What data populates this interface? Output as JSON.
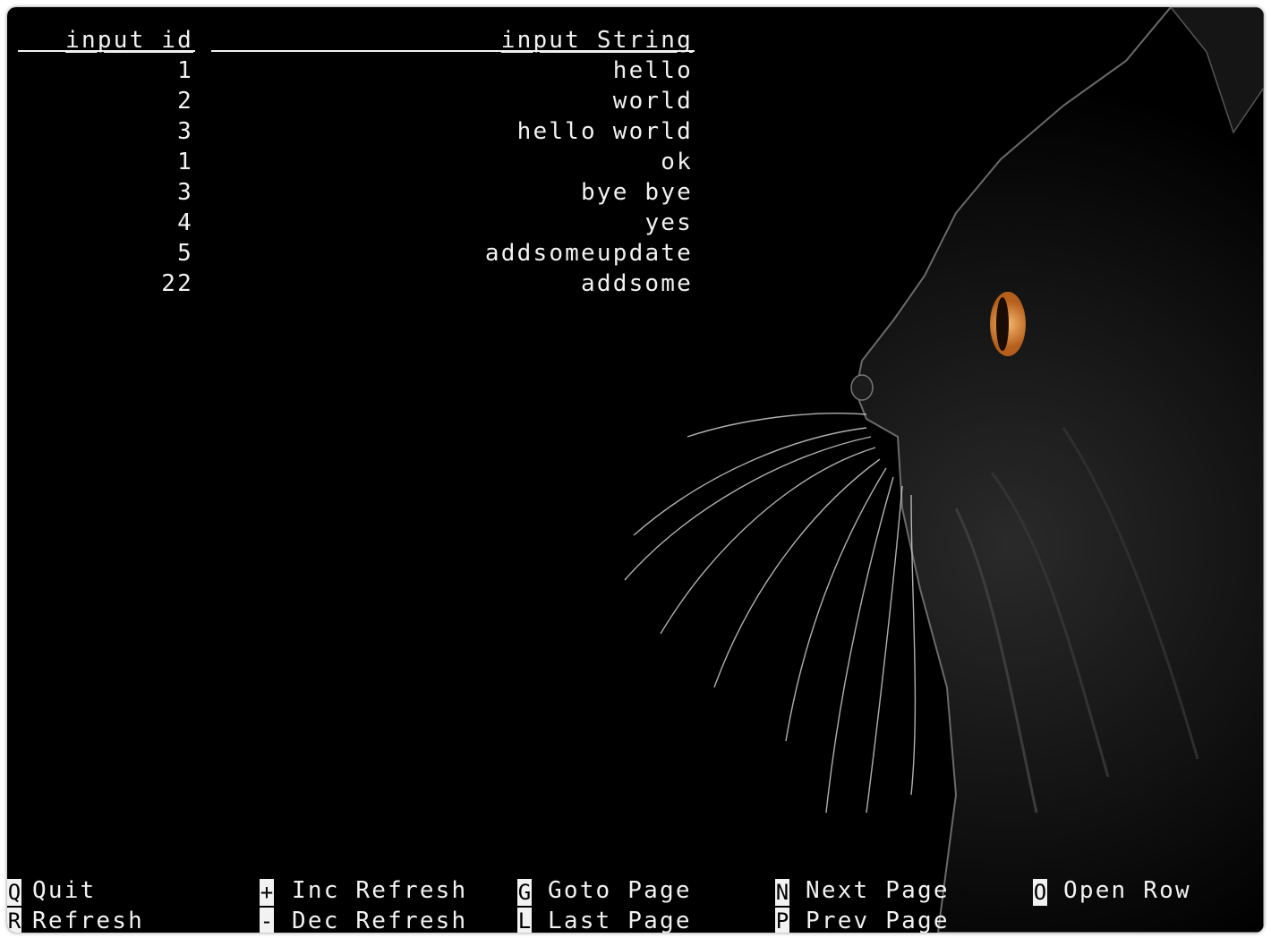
{
  "table": {
    "headers": [
      "input_id",
      "input_String"
    ],
    "rows": [
      {
        "id": "1",
        "str": "hello"
      },
      {
        "id": "2",
        "str": "world"
      },
      {
        "id": "3",
        "str": "hello world"
      },
      {
        "id": "1",
        "str": "ok"
      },
      {
        "id": "3",
        "str": "bye bye"
      },
      {
        "id": "4",
        "str": "yes"
      },
      {
        "id": "5",
        "str": "addsomeupdate"
      },
      {
        "id": "22",
        "str": "addsome"
      }
    ]
  },
  "footer": [
    {
      "key": "Q",
      "label": "Quit"
    },
    {
      "key": "R",
      "label": "Refresh"
    },
    {
      "key": "+",
      "label": "Inc Refresh"
    },
    {
      "key": "-",
      "label": "Dec Refresh"
    },
    {
      "key": "G",
      "label": "Goto Page"
    },
    {
      "key": "L",
      "label": "Last Page"
    },
    {
      "key": "N",
      "label": "Next Page"
    },
    {
      "key": "P",
      "label": "Prev Page"
    },
    {
      "key": "O",
      "label": "Open Row"
    }
  ],
  "colors": {
    "background": "#000000",
    "text": "#f2f2f2",
    "eye": "#e08a3c"
  },
  "icons": {
    "background": "black-cat-wallpaper"
  }
}
